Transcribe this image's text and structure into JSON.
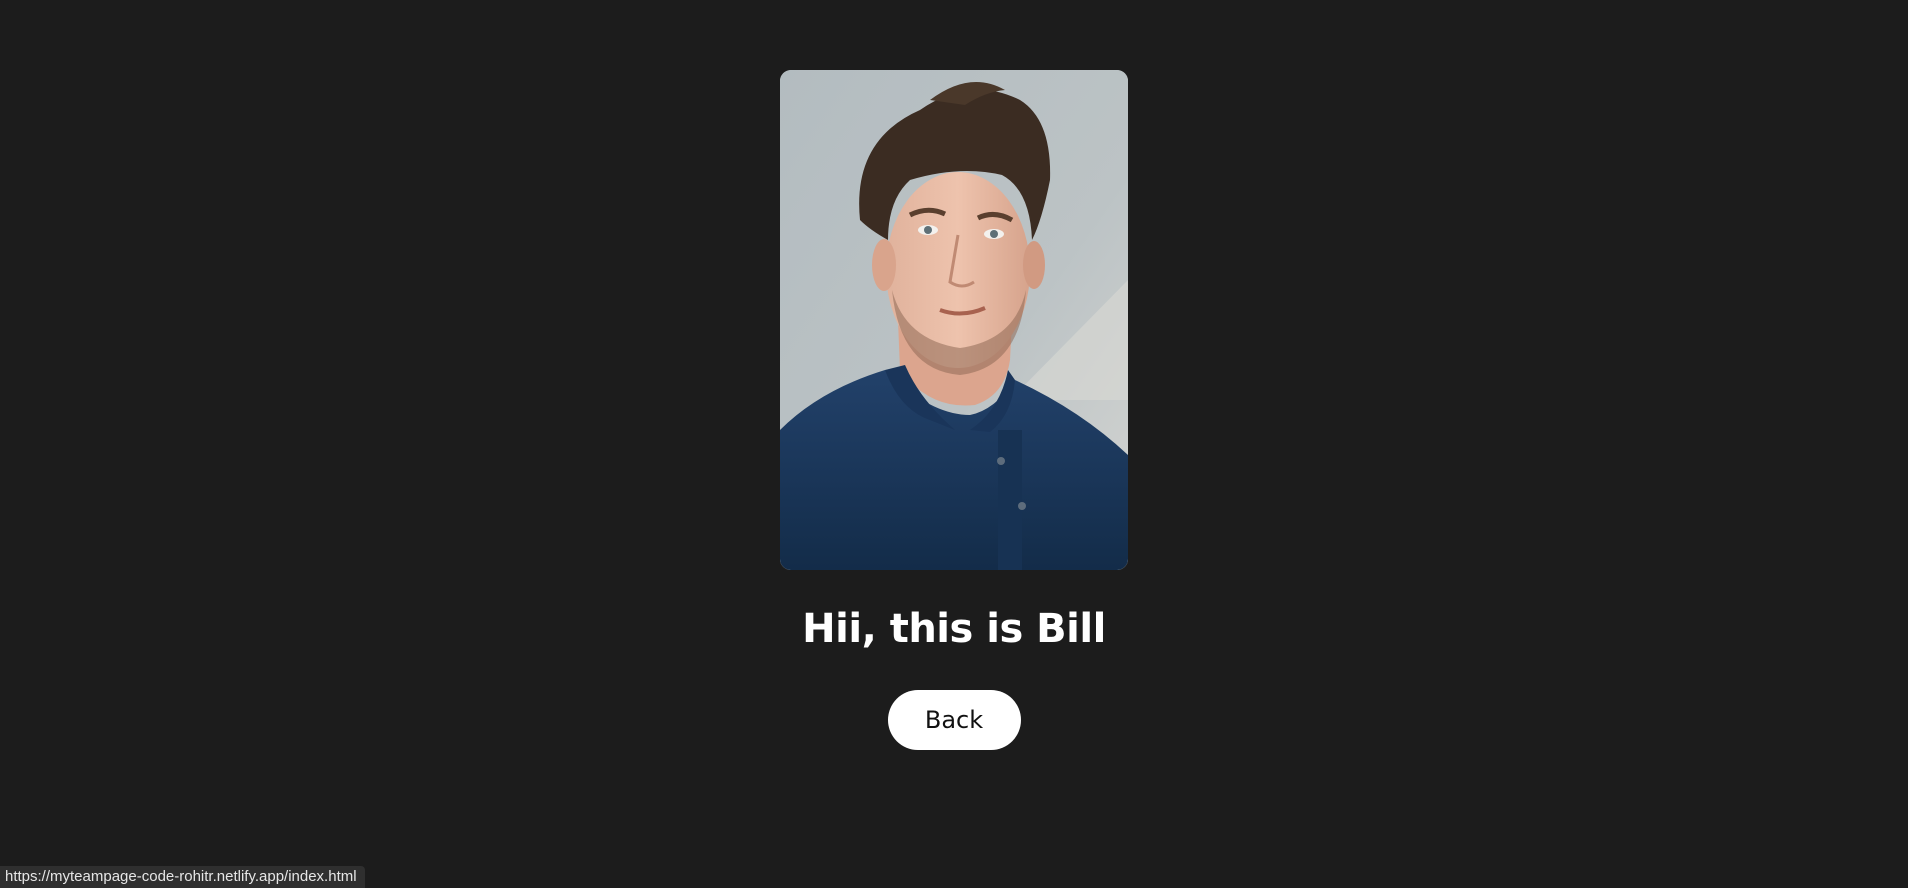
{
  "profile": {
    "photo_alt": "Bill",
    "heading": "Hii, this is Bill",
    "back_label": "Back"
  },
  "status_bar": {
    "url": "https://myteampage-code-rohitr.netlify.app/index.html"
  },
  "colors": {
    "page_background": "#1c1c1c",
    "button_background": "#ffffff",
    "heading_text": "#ffffff",
    "photo_background": "#b9c1c4",
    "shirt": "#1d3a5c"
  }
}
